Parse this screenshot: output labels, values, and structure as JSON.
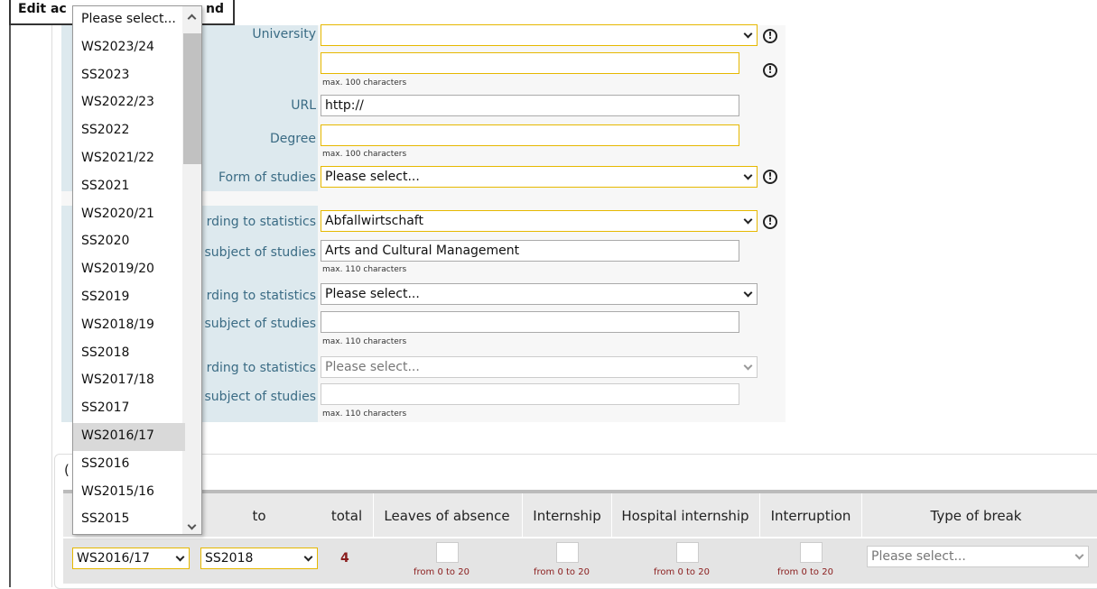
{
  "header": {
    "title_visible": "Edit ac",
    "title_suffix": "nd"
  },
  "form": {
    "university_label": "University",
    "field2_hint": "max. 100 characters",
    "url_label": "URL",
    "url_value": "http://",
    "degree_label": "Degree",
    "degree_hint": "max. 100 characters",
    "form_of_studies_label": "Form of studies",
    "form_of_studies_value": "Please select...",
    "stat1_label": "rding to statistics",
    "stat1_value": "Abfallwirtschaft",
    "subj1_label": "subject of studies",
    "subj1_value": "Arts and Cultural Management",
    "subj1_hint": "max. 110 characters",
    "stat2_label": "rding to statistics",
    "stat2_value": "Please select...",
    "subj2_label": "subject of studies",
    "subj2_hint": "max. 110 characters",
    "stat3_label": "rding to statistics",
    "stat3_value": "Please select...",
    "subj3_label": "subject of studies",
    "subj3_hint": "max. 110 characters",
    "warn_symbol": "!"
  },
  "section": {
    "tab_letter": "(",
    "headers": {
      "to": "to",
      "total": "total",
      "leaves": "Leaves of absence",
      "internship": "Internship",
      "hospital": "Hospital internship",
      "interruption": "Interruption",
      "type_of_break": "Type of break"
    },
    "row": {
      "from_value": "WS2016/17",
      "to_value": "SS2018",
      "total_value": "4",
      "range_text": "from 0 to 20",
      "break_value": "Please select..."
    }
  },
  "dropdown": {
    "selected": "WS2016/17",
    "options": [
      "Please select...",
      "WS2023/24",
      "SS2023",
      "WS2022/23",
      "SS2022",
      "WS2021/22",
      "SS2021",
      "WS2020/21",
      "SS2020",
      "WS2019/20",
      "SS2019",
      "WS2018/19",
      "SS2018",
      "WS2017/18",
      "SS2017",
      "WS2016/17",
      "SS2016",
      "WS2015/16",
      "SS2015"
    ]
  },
  "colors": {
    "label_text": "#3a6b84",
    "label_bg": "#dde9ee",
    "required_border": "#e6b800",
    "range_text": "#8a1c1c"
  }
}
